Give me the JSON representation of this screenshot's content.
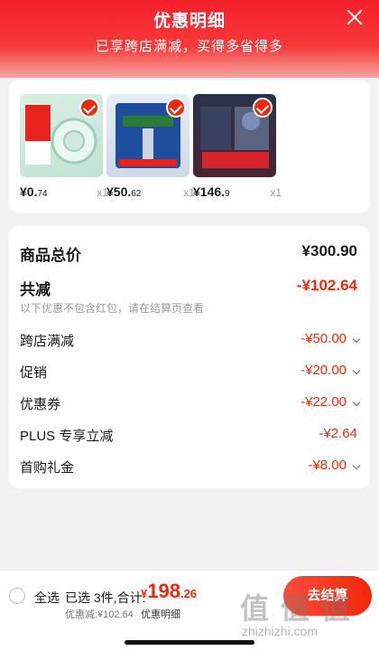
{
  "header": {
    "title": "优惠明细",
    "subtitle": "已享跨店满减，买得多省得多"
  },
  "products": [
    {
      "name": "tape-product",
      "price_int": "¥0.",
      "price_dec": "74",
      "qty": "x1"
    },
    {
      "name": "gillette-razor-product",
      "price_int": "¥50.",
      "price_dec": "62",
      "qty": "x1"
    },
    {
      "name": "gillette-360-product",
      "price_int": "¥146.",
      "price_dec": "9",
      "qty": "x1"
    }
  ],
  "summary": {
    "total_label": "商品总价",
    "total_value": "¥300.90",
    "reduce_label": "共减",
    "reduce_value": "-¥102.64",
    "note": "以下优惠不包含红包，请在结算页查看",
    "items": [
      {
        "label": "跨店满减",
        "value": "-¥50.00"
      },
      {
        "label": "促销",
        "value": "-¥20.00"
      },
      {
        "label": "优惠券",
        "value": "-¥22.00"
      },
      {
        "label": "PLUS 专享立减",
        "value": "-¥2.64"
      },
      {
        "label": "首购礼金",
        "value": "-¥8.00"
      }
    ]
  },
  "footer": {
    "select_all": "全选",
    "selected": "已选 3件,合计:",
    "price_cur": "¥",
    "price_int": "198",
    "price_dec": ".26",
    "reduced": "优惠减:¥102.64",
    "detail": "优惠明细",
    "checkout": "去结算"
  },
  "watermark": {
    "text": "值 值 值",
    "url": "zhizhizhi.com"
  },
  "colors": {
    "accent": "#f2270c",
    "header": "#f5202a"
  }
}
